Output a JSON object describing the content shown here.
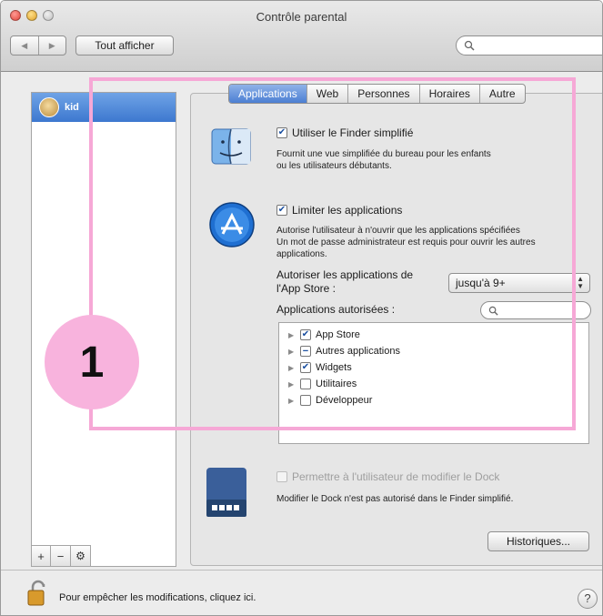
{
  "window": {
    "title": "Contrôle parental",
    "show_all_label": "Tout afficher",
    "nav_back_icon": "back-arrow-icon",
    "nav_forward_icon": "forward-arrow-icon"
  },
  "sidebar": {
    "users": [
      {
        "name": "kid",
        "selected": true
      }
    ],
    "tools": [
      "+",
      "−",
      "⚙"
    ]
  },
  "tabs": [
    {
      "label": "Applications",
      "active": true
    },
    {
      "label": "Web",
      "active": false
    },
    {
      "label": "Personnes",
      "active": false
    },
    {
      "label": "Horaires",
      "active": false
    },
    {
      "label": "Autre",
      "active": false
    }
  ],
  "finder": {
    "checkbox_label": "Utiliser le Finder simplifié",
    "checked": true,
    "desc_line1": "Fournit une vue simplifiée du bureau pour les enfants",
    "desc_line2": "ou les utilisateurs débutants."
  },
  "limit": {
    "checkbox_label": "Limiter les applications",
    "checked": true,
    "desc_line1": "Autorise l'utilisateur à n'ouvrir que les applications spécifiées",
    "desc_line2": "Un mot de passe administrateur est requis pour ouvrir les autres",
    "desc_line3": "applications.",
    "appstore_label_line1": "Autoriser les applications de",
    "appstore_label_line2": "l'App Store :",
    "appstore_value": "jusqu'à 9+",
    "allowed_label": "Applications autorisées :",
    "allowed_search_placeholder": ""
  },
  "app_list": [
    {
      "label": "App Store",
      "state": "checked"
    },
    {
      "label": "Autres applications",
      "state": "mixed"
    },
    {
      "label": "Widgets",
      "state": "checked"
    },
    {
      "label": "Utilitaires",
      "state": "unchecked"
    },
    {
      "label": "Développeur",
      "state": "unchecked"
    }
  ],
  "dock": {
    "checkbox_label": "Permettre à l'utilisateur de modifier le Dock",
    "enabled": false,
    "desc": "Modifier le Dock n'est pas autorisé dans le Finder simplifié."
  },
  "history_button_label": "Historiques...",
  "footer": {
    "lock_text": "Pour empêcher les modifications, cliquez ici.",
    "help_label": "?"
  },
  "annotation": {
    "badge_number": "1",
    "color": "#f6a8d6"
  }
}
